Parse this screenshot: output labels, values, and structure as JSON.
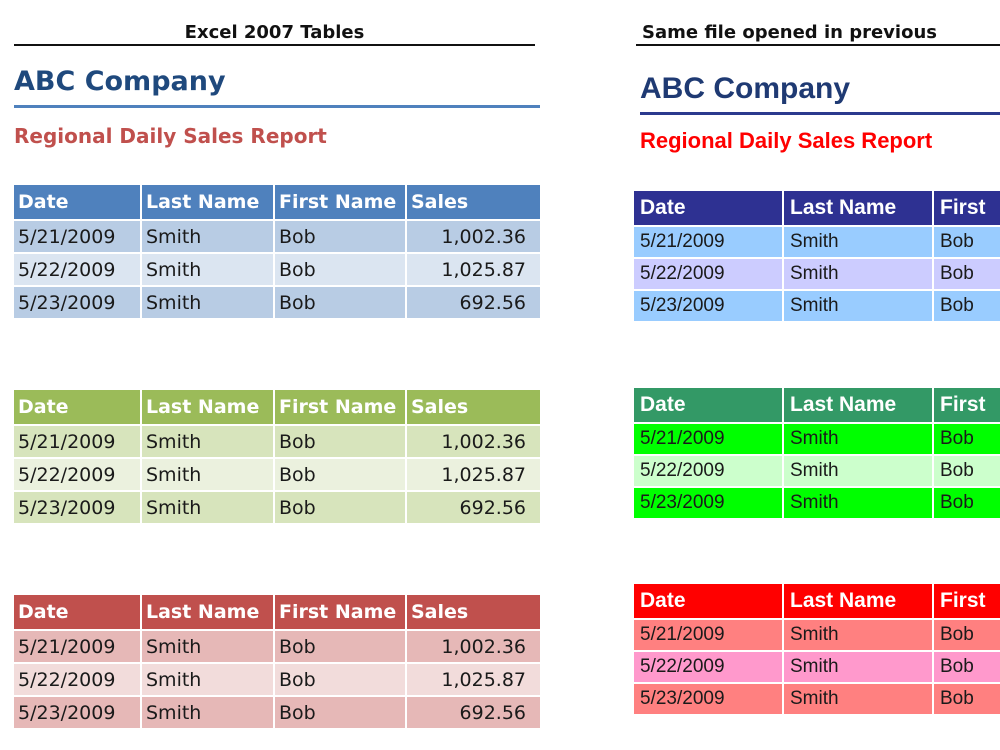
{
  "left": {
    "heading": "Excel 2007 Tables",
    "company": "ABC Company",
    "subtitle": "Regional Daily Sales Report",
    "columns": [
      "Date",
      "Last Name",
      "First Name",
      "Sales"
    ],
    "rows": [
      [
        "5/21/2009",
        "Smith",
        "Bob",
        "1,002.36"
      ],
      [
        "5/22/2009",
        "Smith",
        "Bob",
        "1,025.87"
      ],
      [
        "5/23/2009",
        "Smith",
        "Bob",
        "692.56"
      ]
    ],
    "tables": [
      {
        "theme": "blue",
        "header_color": "#4f81bd",
        "band_color": "#b8cce4",
        "alt_color": "#dbe5f1"
      },
      {
        "theme": "green",
        "header_color": "#9bbb59",
        "band_color": "#d7e4bc",
        "alt_color": "#ebf1de"
      },
      {
        "theme": "red",
        "header_color": "#c0504d",
        "band_color": "#e6b8b7",
        "alt_color": "#f2dcdb"
      }
    ]
  },
  "right": {
    "heading": "Same file opened in previous",
    "company": "ABC Company",
    "subtitle": "Regional Daily Sales Report",
    "columns": [
      "Date",
      "Last Name",
      "First"
    ],
    "rows": [
      [
        "5/21/2009",
        "Smith",
        "Bob"
      ],
      [
        "5/22/2009",
        "Smith",
        "Bob"
      ],
      [
        "5/23/2009",
        "Smith",
        "Bob"
      ]
    ],
    "tables": [
      {
        "theme": "blue",
        "header_color": "#2e3192",
        "band_color": "#99ccff",
        "alt_color": "#ccccff"
      },
      {
        "theme": "green",
        "header_color": "#339966",
        "band_color": "#00ff00",
        "alt_color": "#ccffcc"
      },
      {
        "theme": "red",
        "header_color": "#ff0000",
        "band_color": "#ff8080",
        "alt_color": "#ff99cc"
      }
    ]
  }
}
